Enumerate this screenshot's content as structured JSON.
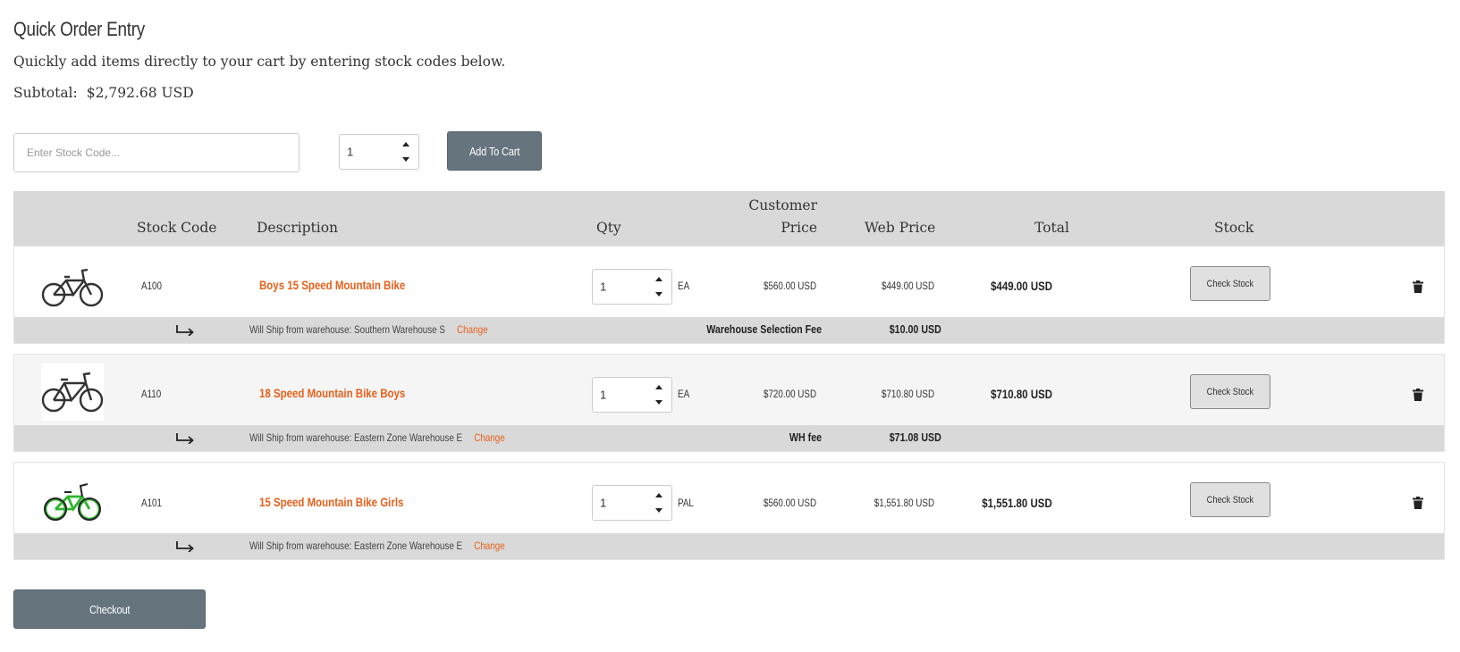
{
  "page": {
    "title": "Quick Order Entry",
    "intro": "Quickly add items directly to your cart by entering stock codes below.",
    "subtotal_label": "Subtotal:",
    "subtotal_value": "$2,792.68 USD"
  },
  "entry": {
    "stock_placeholder": "Enter Stock Code...",
    "qty": "1",
    "add_button": "Add To Cart"
  },
  "table": {
    "headers": {
      "stock_code": "Stock Code",
      "description": "Description",
      "qty": "Qty",
      "customer_price_1": "Customer",
      "customer_price_2": "Price",
      "web_price": "Web Price",
      "total": "Total",
      "stock": "Stock"
    },
    "rows": [
      {
        "stock_code": "A100",
        "description": "Boys 15 Speed Mountain Bike",
        "qty": "1",
        "unit": "EA",
        "customer_price": "$560.00 USD",
        "web_price": "$449.00 USD",
        "total": "$449.00 USD",
        "check_stock": "Check Stock",
        "ship_text": "Will Ship from warehouse: Southern Warehouse S",
        "change": "Change",
        "fee_label": "Warehouse Selection Fee",
        "fee_value": "$10.00 USD",
        "bike_color": "#333333"
      },
      {
        "stock_code": "A110",
        "description": "18 Speed Mountain Bike Boys",
        "qty": "1",
        "unit": "EA",
        "customer_price": "$720.00 USD",
        "web_price": "$710.80 USD",
        "total": "$710.80 USD",
        "check_stock": "Check Stock",
        "ship_text": "Will Ship from warehouse: Eastern Zone Warehouse E",
        "change": "Change",
        "fee_label": "WH fee",
        "fee_value": "$71.08 USD",
        "bike_color": "#333333"
      },
      {
        "stock_code": "A101",
        "description": "15 Speed Mountain Bike Girls",
        "qty": "1",
        "unit": "PAL",
        "customer_price": "$560.00 USD",
        "web_price": "$1,551.80 USD",
        "total": "$1,551.80 USD",
        "check_stock": "Check Stock",
        "ship_text": "Will Ship from warehouse: Eastern Zone Warehouse E",
        "change": "Change",
        "fee_label": "",
        "fee_value": "",
        "bike_color": "#2fb52f"
      }
    ]
  },
  "footer": {
    "checkout": "Checkout"
  },
  "colors": {
    "accent": "#e8601c",
    "button": "#66747e",
    "header_bg": "#d9d9d9"
  },
  "icons": {
    "delete": "trash-icon",
    "ship_arrow": "return-arrow-icon",
    "product": "bicycle-icon"
  }
}
